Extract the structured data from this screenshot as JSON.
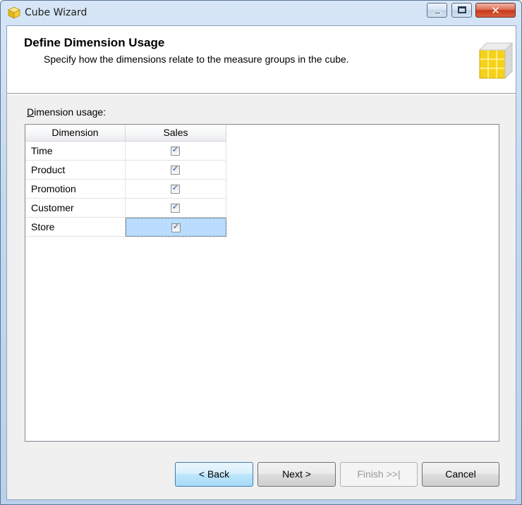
{
  "window": {
    "title": "Cube Wizard",
    "close_glyph": "✕"
  },
  "header": {
    "title": "Define Dimension Usage",
    "subtitle": "Specify how the dimensions relate to the measure groups in the cube."
  },
  "usage": {
    "label_accel": "D",
    "label_rest": "imension usage:",
    "columns": [
      "Dimension",
      "Sales"
    ],
    "rows": [
      {
        "dimension": "Time",
        "sales_checked": true,
        "check": "✓"
      },
      {
        "dimension": "Product",
        "sales_checked": true,
        "check": "✓"
      },
      {
        "dimension": "Promotion",
        "sales_checked": true,
        "check": "✓"
      },
      {
        "dimension": "Customer",
        "sales_checked": true,
        "check": "✓"
      },
      {
        "dimension": "Store",
        "sales_checked": true,
        "check": "✓",
        "selected": true
      }
    ]
  },
  "buttons": {
    "back": "< Back",
    "next": "Next >",
    "finish": "Finish >>|",
    "cancel": "Cancel"
  },
  "colors": {
    "selection": "#b9dcff",
    "cube_yellow": "#f5d21a"
  },
  "icons": {
    "app": "cube-icon",
    "header": "cube-grid-icon"
  }
}
